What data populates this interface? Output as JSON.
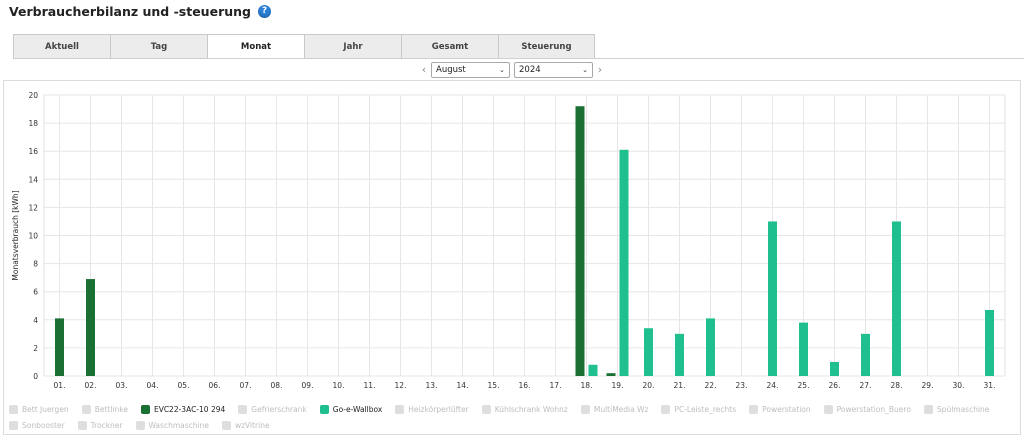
{
  "page": {
    "title": "Verbraucherbilanz und -steuerung"
  },
  "tabs": [
    {
      "label": "Aktuell",
      "active": false
    },
    {
      "label": "Tag",
      "active": false
    },
    {
      "label": "Monat",
      "active": true
    },
    {
      "label": "Jahr",
      "active": false
    },
    {
      "label": "Gesamt",
      "active": false
    },
    {
      "label": "Steuerung",
      "active": false
    }
  ],
  "selectors": {
    "month": "August",
    "year": "2024"
  },
  "colors": {
    "evc": "#1a6f33",
    "wallbox": "#1fbf8f",
    "grid": "#e6e6e6",
    "inactive_legend": "#dedede"
  },
  "legend": [
    {
      "label": "Bett Juergen",
      "active": false,
      "color": "#dedede"
    },
    {
      "label": "Bettlinke",
      "active": false,
      "color": "#dedede"
    },
    {
      "label": "EVC22-3AC-10 294",
      "active": true,
      "color": "#1a6f33"
    },
    {
      "label": "Gefrierschrank",
      "active": false,
      "color": "#dedede"
    },
    {
      "label": "Go-e-Wallbox",
      "active": true,
      "color": "#1fbf8f"
    },
    {
      "label": "Heizkörperlüfter",
      "active": false,
      "color": "#dedede"
    },
    {
      "label": "Kühlschrank Wohnz",
      "active": false,
      "color": "#dedede"
    },
    {
      "label": "MultiMedia Wz",
      "active": false,
      "color": "#dedede"
    },
    {
      "label": "PC-Leiste_rechts",
      "active": false,
      "color": "#dedede"
    },
    {
      "label": "Powerstation",
      "active": false,
      "color": "#dedede"
    },
    {
      "label": "Powerstation_Buero",
      "active": false,
      "color": "#dedede"
    },
    {
      "label": "Spülmaschine",
      "active": false,
      "color": "#dedede"
    },
    {
      "label": "Sonbooster",
      "active": false,
      "color": "#dedede"
    },
    {
      "label": "Trockner",
      "active": false,
      "color": "#dedede"
    },
    {
      "label": "Waschmaschine",
      "active": false,
      "color": "#dedede"
    },
    {
      "label": "wzVitrine",
      "active": false,
      "color": "#dedede"
    }
  ],
  "chart_data": {
    "type": "bar",
    "ylabel": "Monatsverbrauch [kWh]",
    "ylim": [
      0,
      20
    ],
    "yticks": [
      0,
      2,
      4,
      6,
      8,
      10,
      12,
      14,
      16,
      18,
      20
    ],
    "grid": true,
    "categories": [
      "01.",
      "02.",
      "03.",
      "04.",
      "05.",
      "06.",
      "07.",
      "08.",
      "09.",
      "10.",
      "11.",
      "12.",
      "13.",
      "14.",
      "15.",
      "16.",
      "17.",
      "18.",
      "19.",
      "20.",
      "21.",
      "22.",
      "23.",
      "24.",
      "25.",
      "26.",
      "27.",
      "28.",
      "29.",
      "30.",
      "31."
    ],
    "series": [
      {
        "name": "EVC22-3AC-10 294",
        "color": "#1a6f33",
        "values": [
          4.1,
          6.9,
          0,
          0,
          0,
          0,
          0,
          0,
          0,
          0,
          0,
          0,
          0,
          0,
          0,
          0,
          0,
          19.2,
          0.2,
          0,
          0,
          0,
          0,
          0,
          0,
          0,
          0,
          0,
          0,
          0,
          0
        ]
      },
      {
        "name": "Go-e-Wallbox",
        "color": "#1fbf8f",
        "values": [
          0,
          0,
          0,
          0,
          0,
          0,
          0,
          0,
          0,
          0,
          0,
          0,
          0,
          0,
          0,
          0,
          0,
          0.8,
          16.1,
          3.4,
          3.0,
          4.1,
          0,
          11.0,
          3.8,
          1.0,
          3.0,
          11.0,
          0,
          0,
          4.7
        ]
      }
    ]
  }
}
